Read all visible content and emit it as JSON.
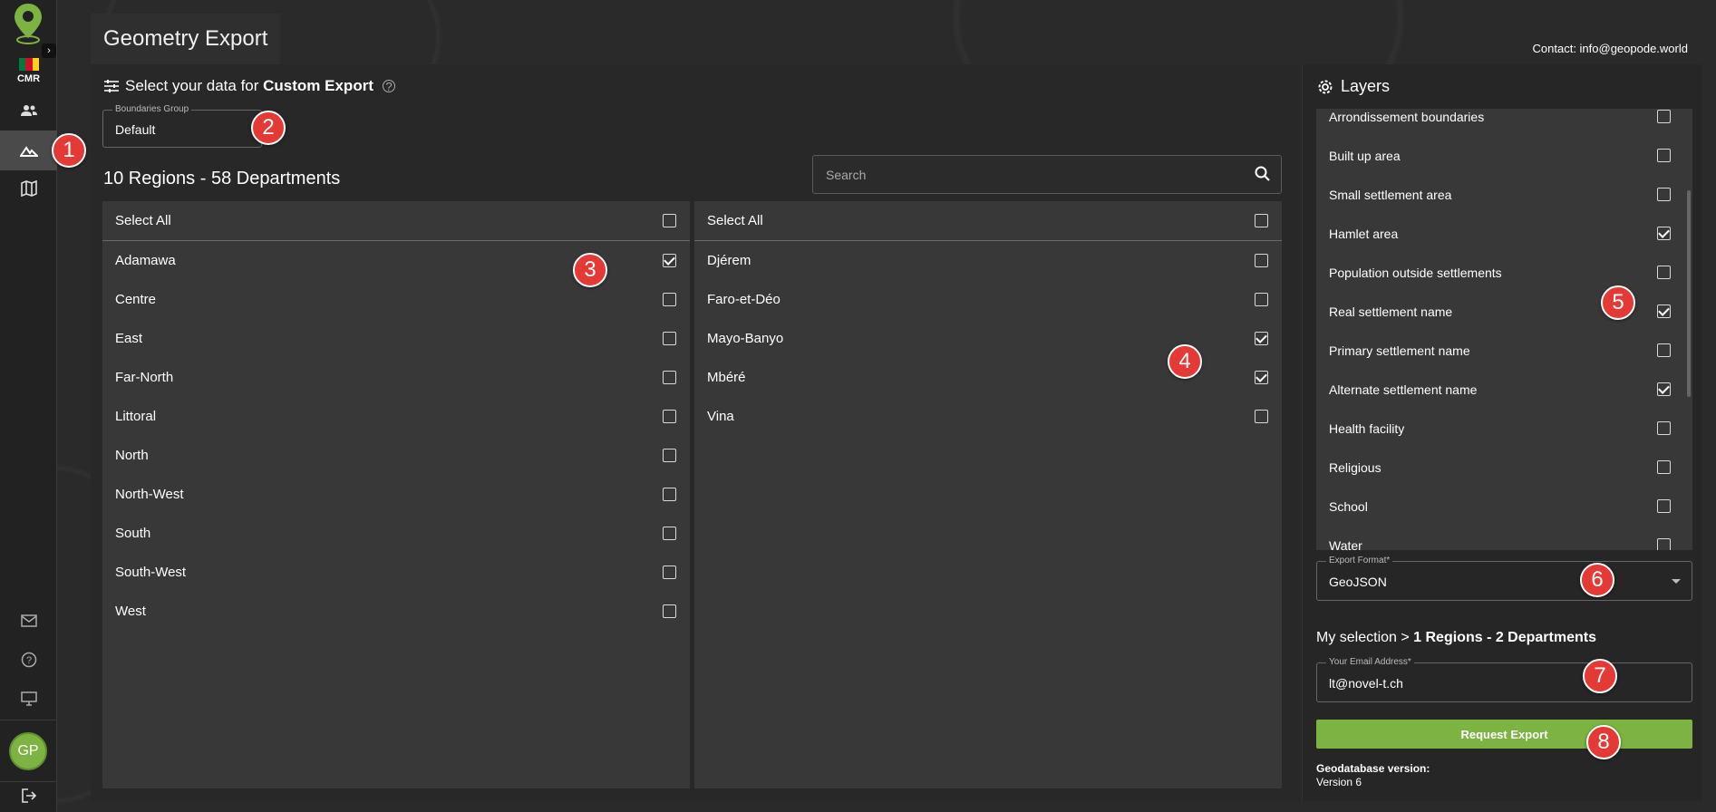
{
  "app": {
    "title": "Geometry Export",
    "contact": "Contact: info@geopode.world",
    "country_code": "CMR",
    "avatar_initials": "GP",
    "colors": {
      "accent": "#7cb342",
      "callout": "#e53935",
      "flag": [
        "#007a3d",
        "#ce1126",
        "#fcd116"
      ]
    }
  },
  "sidebar": {
    "icons": [
      "people-icon",
      "terrain-icon",
      "map-icon",
      "mail-icon",
      "help-icon",
      "monitor-icon",
      "logout-icon"
    ]
  },
  "main": {
    "heading_prefix": "Select your data for ",
    "heading_bold": "Custom Export",
    "boundaries_group": {
      "label": "Boundaries Group",
      "value": "Default"
    },
    "counts": "10 Regions - 58 Departments",
    "search": {
      "placeholder": "Search",
      "value": ""
    },
    "regions": {
      "select_all": "Select All",
      "select_all_checked": false,
      "items": [
        {
          "label": "Adamawa",
          "checked": true
        },
        {
          "label": "Centre",
          "checked": false
        },
        {
          "label": "East",
          "checked": false
        },
        {
          "label": "Far-North",
          "checked": false
        },
        {
          "label": "Littoral",
          "checked": false
        },
        {
          "label": "North",
          "checked": false
        },
        {
          "label": "North-West",
          "checked": false
        },
        {
          "label": "South",
          "checked": false
        },
        {
          "label": "South-West",
          "checked": false
        },
        {
          "label": "West",
          "checked": false
        }
      ]
    },
    "departments": {
      "select_all": "Select All",
      "select_all_checked": false,
      "items": [
        {
          "label": "Djérem",
          "checked": false
        },
        {
          "label": "Faro-et-Déo",
          "checked": false
        },
        {
          "label": "Mayo-Banyo",
          "checked": true
        },
        {
          "label": "Mbéré",
          "checked": true
        },
        {
          "label": "Vina",
          "checked": false
        }
      ]
    }
  },
  "layers": {
    "title": "Layers",
    "items": [
      {
        "label": "Arrondissement boundaries",
        "checked": false
      },
      {
        "label": "Built up area",
        "checked": false
      },
      {
        "label": "Small settlement area",
        "checked": false
      },
      {
        "label": "Hamlet area",
        "checked": true
      },
      {
        "label": "Population outside settlements",
        "checked": false
      },
      {
        "label": "Real settlement name",
        "checked": true
      },
      {
        "label": "Primary settlement name",
        "checked": false
      },
      {
        "label": "Alternate settlement name",
        "checked": true
      },
      {
        "label": "Health facility",
        "checked": false
      },
      {
        "label": "Religious",
        "checked": false
      },
      {
        "label": "School",
        "checked": false
      },
      {
        "label": "Water",
        "checked": false
      }
    ],
    "export_format": {
      "label": "Export Format*",
      "value": "GeoJSON"
    },
    "selection_prefix": "My selection > ",
    "selection_bold": "1 Regions - 2 Departments",
    "email": {
      "label": "Your Email Address*",
      "value": "lt@novel-t.ch"
    },
    "request_button": "Request Export",
    "gdb_label": "Geodatabase version:",
    "gdb_value": "Version 6"
  },
  "callouts": [
    "1",
    "2",
    "3",
    "4",
    "5",
    "6",
    "7",
    "8"
  ]
}
